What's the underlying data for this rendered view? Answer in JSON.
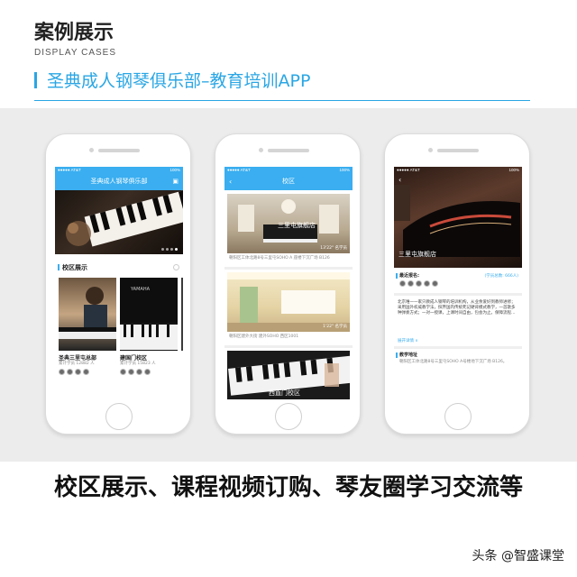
{
  "header": {
    "title": "案例展示",
    "subtitle": "DISPLAY CASES",
    "app_name": "圣典成人钢琴俱乐部–教育培训APP"
  },
  "caption": "校区展示、课程视频订购、琴友圈学习交流等",
  "watermark": "头条 @智盛课堂",
  "colors": {
    "accent": "#2aa6e4",
    "navbar": "#3aaef0"
  },
  "phone1": {
    "status_left": "●●●●● AT&T",
    "status_right": "100%",
    "nav_title": "圣典成人钢琴俱乐部",
    "section_title": "校区展示",
    "card1": {
      "name": "圣典三里屯总部",
      "info": "累计学员 12882 人"
    },
    "card2": {
      "name": "建国门校区",
      "info": "累计学员 15823 人"
    }
  },
  "phone2": {
    "status_left": "●●●●● AT&T",
    "status_right": "100%",
    "nav_title": "校区",
    "item1": {
      "overlay": "三里屯旗舰店",
      "badge": "13'22\" 名学员",
      "address": "朝阳区工体北路8号三里屯SOHO A 座楼下沉广场 B126"
    },
    "item2": {
      "badge": "1'22\" 名学员",
      "address": "朝阳区建外大街 建外SOHO 西区1001"
    },
    "item3": {
      "overlay": "西直门校区"
    }
  },
  "phone3": {
    "status_left": "●●●●● AT&T",
    "status_right": "100%",
    "overlay": "三里屯旗舰店",
    "recent_label": "最近报名:",
    "recent_count": "(学员总数: 666人)",
    "description": "北京唯一一家只教成人钢琴的培训机构，从业余爱好到教师进修；采用国外权威教学法，摈弃国内传统死记硬背模式教学，一首歌多种弹奏方式；一对一授课，上课时间自由，包会为止。保障流程…",
    "expand": "展开详情 ∨",
    "address_title": "教学地址",
    "address": "朝阳区工体北路8号三里屯SOHO A号楼地下沉广场 B126。"
  }
}
